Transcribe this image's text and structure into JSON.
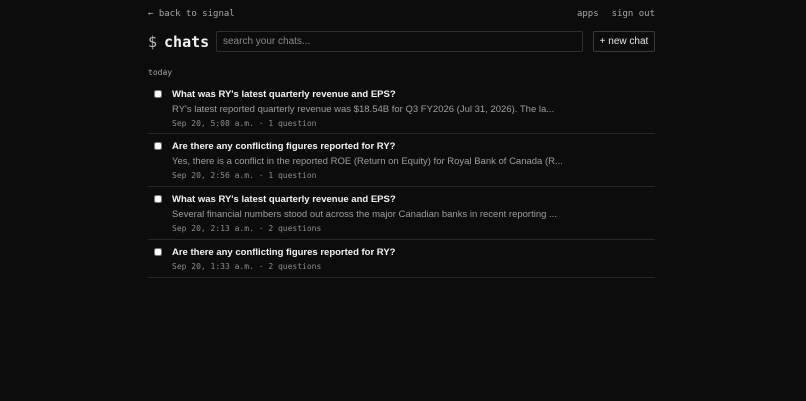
{
  "nav": {
    "back_label": "← back to signal",
    "apps_label": "apps",
    "signout_label": "sign out"
  },
  "header": {
    "prompt_symbol": "$",
    "title": "chats",
    "search_placeholder": "search your chats...",
    "new_chat_label": "+ new chat"
  },
  "section": {
    "label": "today"
  },
  "chats": [
    {
      "title": "What was RY's latest quarterly revenue and EPS?",
      "preview": "RY's latest reported quarterly revenue was $18.54B for Q3 FY2026 (Jul 31, 2026). The la...",
      "meta": "Sep 20, 5:08 a.m. · 1 question",
      "checked": false
    },
    {
      "title": "Are there any conflicting figures reported for RY?",
      "preview": "Yes, there is a conflict in the reported ROE (Return on Equity) for Royal Bank of Canada (R...",
      "meta": "Sep 20, 2:56 a.m. · 1 question",
      "checked": false
    },
    {
      "title": "What was RY's latest quarterly revenue and EPS?",
      "preview": "Several financial numbers stood out across the major Canadian banks in recent reporting ...",
      "meta": "Sep 20, 2:13 a.m. · 2 questions",
      "checked": false
    },
    {
      "title": "Are there any conflicting figures reported for RY?",
      "preview": "",
      "meta": "Sep 20, 1:33 a.m. · 2 questions",
      "checked": false
    }
  ]
}
